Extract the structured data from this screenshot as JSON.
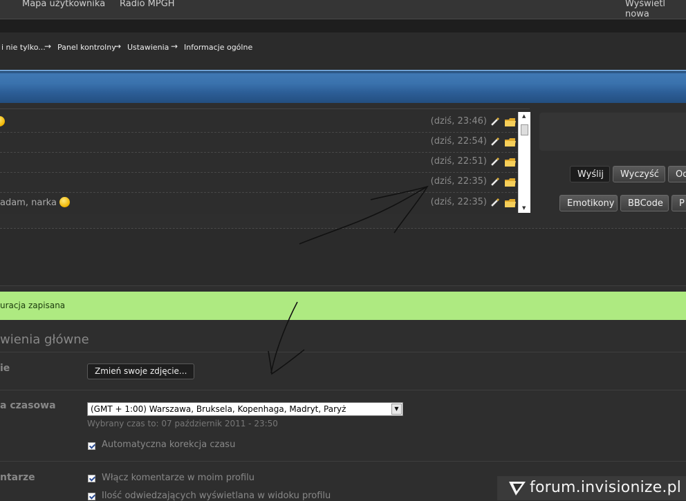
{
  "nav": {
    "items": [
      "Mapa użytkownika",
      "Radio MPGH"
    ],
    "right_link": "Wyświetl nowa"
  },
  "breadcrumb": [
    "i nie tylko...",
    "Panel kontrolny",
    "Ustawienia",
    "Informacje ogólne"
  ],
  "breadcrumb_sep": "→",
  "shoutbox": {
    "rows": [
      {
        "text": "",
        "emote": true,
        "time": "(dziś, 23:46)"
      },
      {
        "text": "",
        "emote": false,
        "time": "(dziś, 22:54)"
      },
      {
        "text": "",
        "emote": false,
        "time": "(dziś, 22:51)"
      },
      {
        "text": "",
        "emote": false,
        "time": "(dziś, 22:35)"
      },
      {
        "text": "adam, narka",
        "emote": true,
        "time": "(dziś, 22:35)"
      }
    ],
    "buttons_row1": [
      "Wyślij",
      "Wyczyść",
      "Od"
    ],
    "buttons_row2": [
      "Emotikony",
      "BBCode",
      "P"
    ]
  },
  "status_message": "uracja zapisana",
  "settings": {
    "section_title": "wienia główne",
    "photo_label": "ie",
    "photo_button": "Zmień swoje zdjęcie...",
    "timezone_label": "a czasowa",
    "timezone_value": "(GMT + 1:00) Warszawa, Bruksela, Kopenhaga, Madryt, Paryż",
    "timezone_hint": "Wybrany czas to: 07 październik 2011 - 23:50",
    "auto_time_label": "Automatyczna korekcja czasu",
    "comments_label": "ntarze",
    "enable_comments": "Włącz komentarze w moim profilu",
    "visitors_label": "Ilość odwiedzających wyświetlana w widoku profilu"
  },
  "watermark": "forum.invisionize.pl",
  "colors": {
    "accent_blue": "#3a72ad",
    "success_bg": "#aeea81",
    "background": "#2e2e2e"
  }
}
